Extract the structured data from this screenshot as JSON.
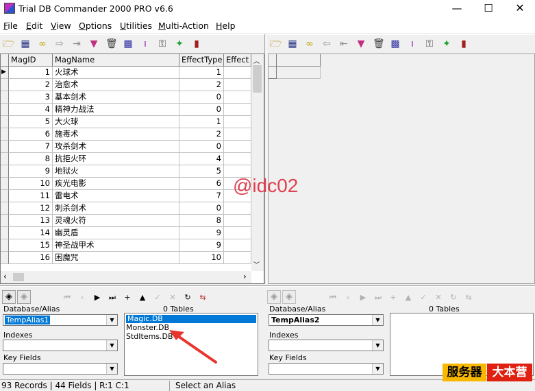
{
  "window": {
    "title": "Trial DB Commander 2000 PRO v6.6",
    "min_glyph": "—",
    "max_glyph": "☐",
    "close_glyph": "✕"
  },
  "menu": [
    {
      "label": "File",
      "accel": "F"
    },
    {
      "label": "Edit",
      "accel": "E"
    },
    {
      "label": "View",
      "accel": "V"
    },
    {
      "label": "Options",
      "accel": "O"
    },
    {
      "label": "Utilities",
      "accel": "U"
    },
    {
      "label": "Multi-Action",
      "accel": "M"
    },
    {
      "label": "Help",
      "accel": "H"
    }
  ],
  "toolbar_left_icons": [
    "open-folder-icon",
    "table-icon",
    "glasses-icon",
    "arrow-right-icon",
    "export-icon",
    "filter-icon",
    "trash-icon",
    "grid-icon",
    "index-icon",
    "key-search-icon",
    "runner-icon",
    "book-icon"
  ],
  "toolbar_right_icons": [
    "open-folder-icon",
    "table-icon",
    "glasses-icon",
    "arrow-left-icon",
    "import-icon",
    "filter-icon",
    "trash-icon",
    "grid-icon",
    "index-icon",
    "key-search-icon",
    "runner-icon",
    "book-icon"
  ],
  "grid": {
    "columns": [
      "MagID",
      "MagName",
      "EffectType",
      "Effect"
    ],
    "rows": [
      {
        "id": "1",
        "name": "火球术",
        "type": "1"
      },
      {
        "id": "2",
        "name": "治愈术",
        "type": "2"
      },
      {
        "id": "3",
        "name": "基本剑术",
        "type": "0"
      },
      {
        "id": "4",
        "name": "精神力战法",
        "type": "0"
      },
      {
        "id": "5",
        "name": "大火球",
        "type": "1"
      },
      {
        "id": "6",
        "name": "施毒术",
        "type": "2"
      },
      {
        "id": "7",
        "name": "攻杀剑术",
        "type": "0"
      },
      {
        "id": "8",
        "name": "抗拒火环",
        "type": "4"
      },
      {
        "id": "9",
        "name": "地狱火",
        "type": "5"
      },
      {
        "id": "10",
        "name": "疾光电影",
        "type": "6"
      },
      {
        "id": "11",
        "name": "雷电术",
        "type": "7"
      },
      {
        "id": "12",
        "name": "刺杀剑术",
        "type": "0"
      },
      {
        "id": "13",
        "name": "灵魂火符",
        "type": "8"
      },
      {
        "id": "14",
        "name": "幽灵盾",
        "type": "9"
      },
      {
        "id": "15",
        "name": "神圣战甲术",
        "type": "9"
      },
      {
        "id": "16",
        "name": "困魔咒",
        "type": "10"
      }
    ]
  },
  "left_panel": {
    "db_alias_label": "Database/Alias",
    "db_alias_value": "TempAlias1",
    "tables_count": "0 Tables",
    "tables": [
      "Magic.DB",
      "Monster.DB",
      "StdItems.DB"
    ],
    "selected_table": "Magic.DB",
    "indexes_label": "Indexes",
    "keyfields_label": "Key Fields"
  },
  "right_panel": {
    "db_alias_label": "Database/Alias",
    "db_alias_value": "TempAlias2",
    "tables_count": "0 Tables",
    "indexes_label": "Indexes",
    "keyfields_label": "Key Fields"
  },
  "status": {
    "records": "93 Records | 44 Fields | R:1 C:1",
    "hint": "Select an Alias"
  },
  "overlay": {
    "watermark": "@idc02",
    "brand_a": "服务器",
    "brand_b": "大本营"
  }
}
